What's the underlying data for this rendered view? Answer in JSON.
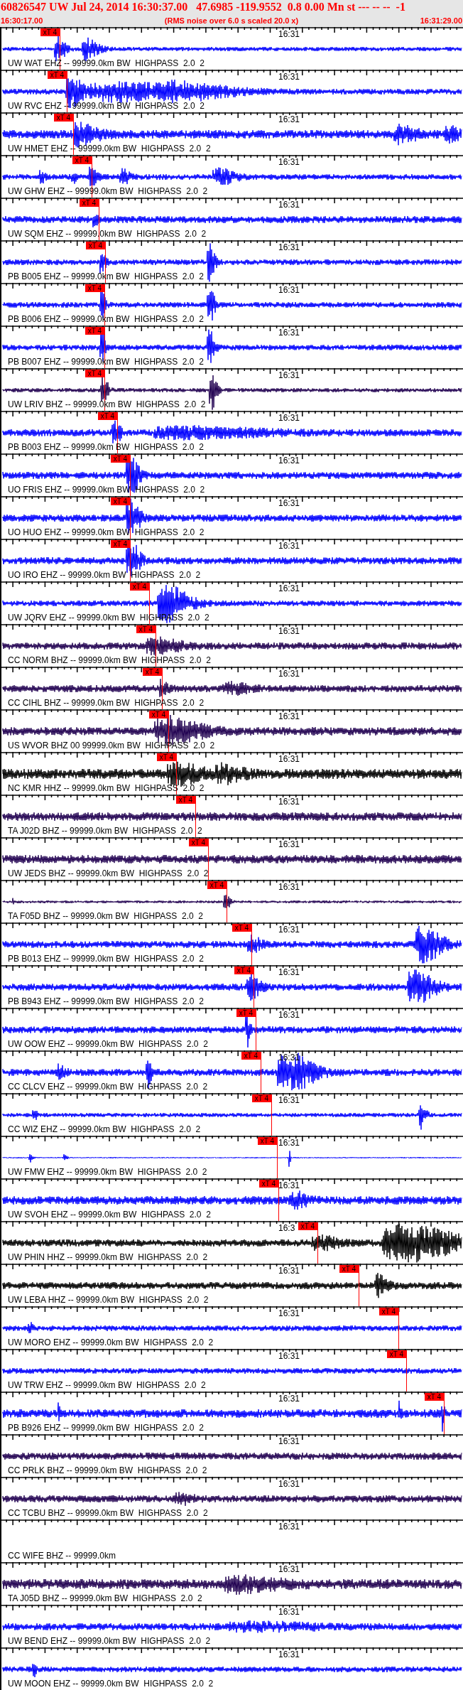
{
  "header": {
    "title": "60826547 UW Jul 24, 2014 16:30:37.00   47.6985 -119.9552  0.8 0.00 Mn st --- -- --  -1",
    "start_time": "16:30:17.00",
    "note": "(RMS noise over 6.0 s scaled 20.0 x)",
    "end_time": "16:31:29.00"
  },
  "traces": [
    {
      "label": "UW WAT EHZ -- 99999.0km BW  HIGHPASS  2.0  2",
      "time_label": "16:31",
      "pick": "xT 4",
      "color": "#0000ff"
    },
    {
      "label": "UW RVC EHZ -- 99999.0km BW  HIGHPASS  2.0  2",
      "time_label": "16:31",
      "pick": "xT 4",
      "color": "#0000ff"
    },
    {
      "label": "UW HMET EHZ -- 99999.0km BW  HIGHPASS  2.0  2",
      "time_label": "16:31",
      "pick": "xT 4",
      "color": "#0000ff"
    },
    {
      "label": "UW GHW EHZ -- 99999.0km BW  HIGHPASS  2.0  2",
      "time_label": "16:31",
      "pick": "xT 4",
      "color": "#0000ff"
    },
    {
      "label": "UW SQM EHZ -- 99999.0km BW  HIGHPASS  2.0  2",
      "time_label": "16:31",
      "pick": "xT 4",
      "color": "#0000ff"
    },
    {
      "label": "PB B005 EHZ -- 99999.0km BW  HIGHPASS  2.0  2",
      "time_label": "16:31",
      "pick": "xT 4",
      "color": "#0000ff"
    },
    {
      "label": "PB B006 EHZ -- 99999.0km BW  HIGHPASS  2.0  2",
      "time_label": "16:31",
      "pick": "xT 4",
      "color": "#0000ff"
    },
    {
      "label": "PB B007 EHZ -- 99999.0km BW  HIGHPASS  2.0  2",
      "time_label": "16:31",
      "pick": "xT 4",
      "color": "#0000ff"
    },
    {
      "label": "UW LRIV BHZ -- 99999.0km BW  HIGHPASS  2.0  2",
      "time_label": "16:31",
      "pick": "xT 4",
      "color": "#200050"
    },
    {
      "label": "PB B003 EHZ -- 99999.0km BW  HIGHPASS  2.0  2",
      "time_label": "16:31",
      "pick": "xT 4",
      "color": "#0000ff"
    },
    {
      "label": "UO FRIS EHZ -- 99999.0km BW  HIGHPASS  2.0  2",
      "time_label": "16:31",
      "pick": "xT 4",
      "color": "#0000ff"
    },
    {
      "label": "UO HUO EHZ -- 99999.0km BW  HIGHPASS  2.0  2",
      "time_label": "16:31",
      "pick": "xT 4",
      "color": "#0000ff"
    },
    {
      "label": "UO IRO EHZ -- 99999.0km BW  HIGHPASS  2.0  2",
      "time_label": "16:31",
      "pick": "xT 4",
      "color": "#0000ff"
    },
    {
      "label": "UW JQRV EHZ -- 99999.0km BW  HIGHPASS  2.0  2",
      "time_label": "16:31",
      "pick": "xT 4",
      "color": "#0000ff"
    },
    {
      "label": "CC NORM BHZ -- 99999.0km BW  HIGHPASS  2.0  2",
      "time_label": "16:31",
      "pick": "xT 4",
      "color": "#200050"
    },
    {
      "label": "CC CIHL BHZ -- 99999.0km BW  HIGHPASS  2.0  2",
      "time_label": "16:31",
      "pick": "xT 4",
      "color": "#200050"
    },
    {
      "label": "US WVOR BHZ 00 99999.0km BW  HIGHPASS  2.0  2",
      "time_label": "16:31",
      "pick": "xT 4",
      "color": "#200050"
    },
    {
      "label": "NC KMR HHZ -- 99999.0km BW  HIGHPASS  2.0  2",
      "time_label": "16:31",
      "pick": "xT 4",
      "color": "#000000"
    },
    {
      "label": "TA J02D BHZ -- 99999.0km BW  HIGHPASS  2.0  2",
      "time_label": "16:31",
      "pick": "xT 4",
      "color": "#200050"
    },
    {
      "label": "UW JEDS BHZ -- 99999.0km BW  HIGHPASS  2.0  2",
      "time_label": "16:31",
      "pick": "xT 4",
      "color": "#200050"
    },
    {
      "label": "TA F05D BHZ -- 99999.0km BW  HIGHPASS  2.0  2",
      "time_label": "16:31",
      "pick": "xT 4",
      "color": "#200050"
    },
    {
      "label": "PB B013 EHZ -- 99999.0km BW  HIGHPASS  2.0  2",
      "time_label": "16:31",
      "pick": "xT 4",
      "color": "#0000ff"
    },
    {
      "label": "PB B943 EHZ -- 99999.0km BW  HIGHPASS  2.0  2",
      "time_label": "16:31",
      "pick": "xT 4",
      "color": "#0000ff"
    },
    {
      "label": "UW OOW EHZ -- 99999.0km BW  HIGHPASS  2.0  2",
      "time_label": "16:31",
      "pick": "xT 4",
      "color": "#0000ff"
    },
    {
      "label": "CC CLCV EHZ -- 99999.0km BW  HIGHPASS  2.0  2",
      "time_label": "16:31",
      "pick": "xT 4",
      "color": "#0000ff"
    },
    {
      "label": "CC WIZ EHZ -- 99999.0km BW  HIGHPASS  2.0  2",
      "time_label": "16:31",
      "pick": "xT 4",
      "color": "#0000ff"
    },
    {
      "label": "UW FMW EHZ -- 99999.0km BW  HIGHPASS  2.0  2",
      "time_label": "16:31",
      "pick": "xT 4",
      "color": "#0000ff"
    },
    {
      "label": "UW SVOH EHZ -- 99999.0km BW  HIGHPASS  2.0  2",
      "time_label": "16:31",
      "pick": "xT 4",
      "color": "#0000ff"
    },
    {
      "label": "UW PHIN HHZ -- 99999.0km BW  HIGHPASS  2.0  2",
      "time_label": "16:3",
      "pick": "xT 4",
      "color": "#000000"
    },
    {
      "label": "UW LEBA HHZ -- 99999.0km BW  HIGHPASS  2.0  2",
      "time_label": "16:31",
      "pick": "xT 4",
      "color": "#000000"
    },
    {
      "label": "UW MORO EHZ -- 99999.0km BW  HIGHPASS  2.0  2",
      "time_label": "16:31",
      "pick": "xT 4",
      "color": "#0000ff"
    },
    {
      "label": "UW TRW EHZ -- 99999.0km BW  HIGHPASS  2.0  2",
      "time_label": "16:31",
      "pick": "xT 4",
      "color": "#0000ff"
    },
    {
      "label": "PB B926 EHZ -- 99999.0km BW  HIGHPASS  2.0  2",
      "time_label": "16:31",
      "pick": "xT 4",
      "color": "#0000ff"
    },
    {
      "label": "CC PRLK BHZ -- 99999.0km BW  HIGHPASS  2.0  2",
      "time_label": "16:31",
      "color": "#200050"
    },
    {
      "label": "CC TCBU BHZ -- 99999.0km BW  HIGHPASS  2.0  2",
      "time_label": "16:31",
      "color": "#200050"
    },
    {
      "label": "CC WIFE BHZ -- 99999.0km",
      "time_label": "16:31"
    },
    {
      "label": "TA J05D BHZ -- 99999.0km BW  HIGHPASS  2.0  2",
      "time_label": "16:31",
      "color": "#200050"
    },
    {
      "label": "UW BEND EHZ -- 99999.0km BW  HIGHPASS  2.0  2",
      "time_label": "16:31",
      "color": "#0000ff"
    },
    {
      "label": "UW MOON EHZ -- 99999.0km BW  HIGHPASS  2.0  2",
      "time_label": "16:31",
      "color": "#0000ff"
    }
  ]
}
